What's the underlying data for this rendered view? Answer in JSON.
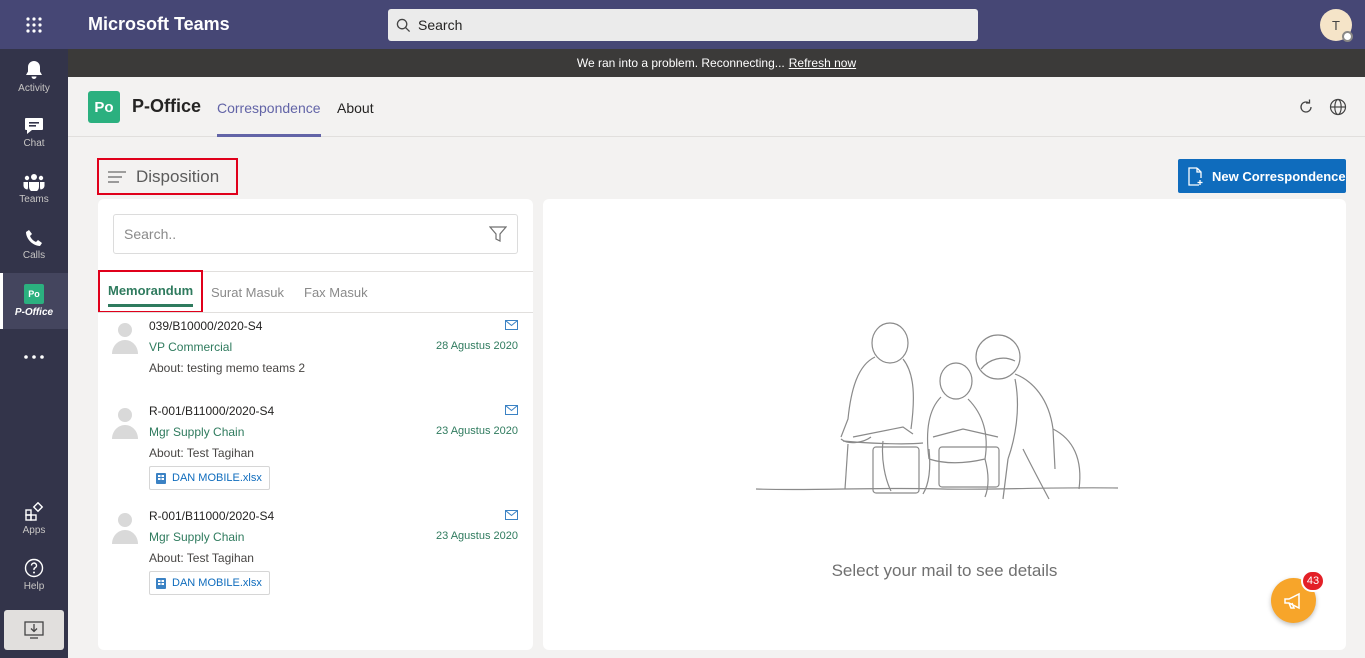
{
  "app": {
    "title": "Microsoft Teams"
  },
  "search": {
    "placeholder": "Search"
  },
  "user": {
    "initial": "T"
  },
  "rail": {
    "activity": "Activity",
    "chat": "Chat",
    "teams": "Teams",
    "calls": "Calls",
    "poffice": "P-Office",
    "apps": "Apps",
    "help": "Help"
  },
  "banner": {
    "text": "We ran into a problem. Reconnecting...",
    "link": "Refresh now"
  },
  "appHeader": {
    "logo": "Po",
    "name": "P-Office",
    "tabs": [
      "Correspondence",
      "About"
    ]
  },
  "page": {
    "title": "Disposition",
    "new_button": "New Correspondence"
  },
  "list": {
    "search_placeholder": "Search..",
    "tabs": [
      "Memorandum",
      "Surat Masuk",
      "Fax Masuk"
    ],
    "items": [
      {
        "number": "039/B10000/2020-S4",
        "from": "VP Commercial",
        "date": "28 Agustus 2020",
        "about": "About: testing memo teams 2",
        "attachment": ""
      },
      {
        "number": "R-001/B11000/2020-S4",
        "from": "Mgr Supply Chain",
        "date": "23 Agustus 2020",
        "about": "About: Test Tagihan",
        "attachment": "DAN MOBILE.xlsx"
      },
      {
        "number": "R-001/B11000/2020-S4",
        "from": "Mgr Supply Chain",
        "date": "23 Agustus 2020",
        "about": "About: Test Tagihan",
        "attachment": "DAN MOBILE.xlsx"
      }
    ]
  },
  "detail": {
    "empty_message": "Select your mail to see details"
  },
  "notifications": {
    "count": "43"
  },
  "colors": {
    "teams_purple": "#464775",
    "rail": "#33344a",
    "accent_green": "#2f7b5e",
    "primary_blue": "#0f6cbd",
    "highlight_red": "#e0001b"
  }
}
